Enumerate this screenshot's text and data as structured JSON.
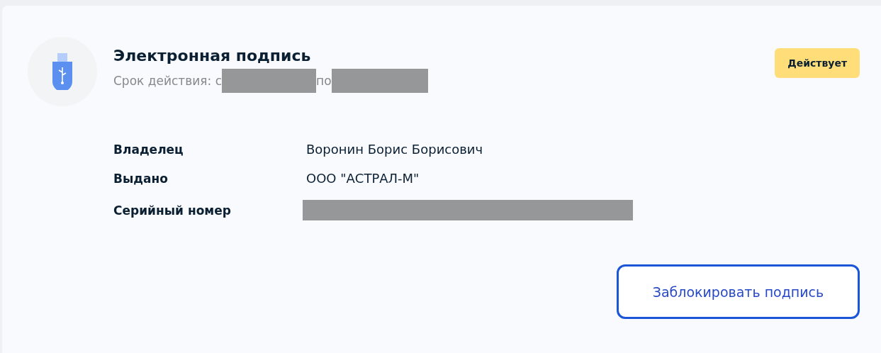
{
  "signature": {
    "title": "Электронная подпись",
    "validity_prefix": "Срок действия: с",
    "validity_middle": "по",
    "status": "Действует"
  },
  "details": [
    {
      "label": "Владелец",
      "value": "Воронин Борис Борисович",
      "redacted": false
    },
    {
      "label": "Выдано",
      "value": "ООО \"АСТРАЛ-М\"",
      "redacted": false
    },
    {
      "label": "Серийный номер",
      "redacted": true
    }
  ],
  "action": "Заблокировать подпись"
}
